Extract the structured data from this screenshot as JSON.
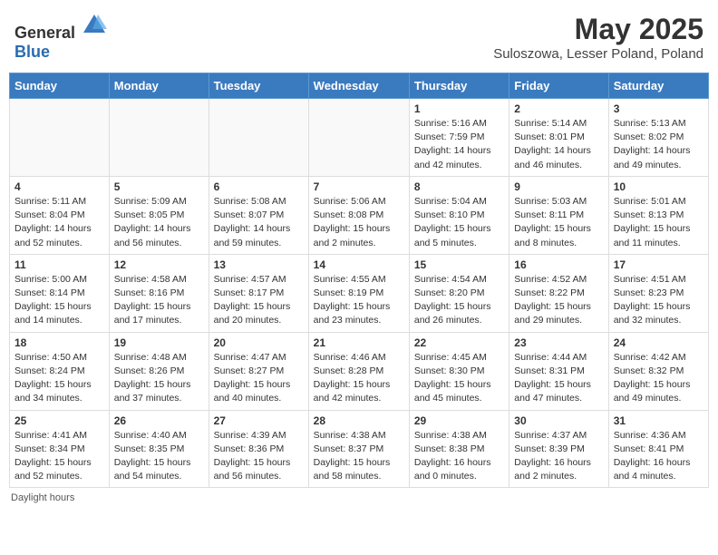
{
  "header": {
    "logo_general": "General",
    "logo_blue": "Blue",
    "title": "May 2025",
    "location": "Suloszowa, Lesser Poland, Poland"
  },
  "weekdays": [
    "Sunday",
    "Monday",
    "Tuesday",
    "Wednesday",
    "Thursday",
    "Friday",
    "Saturday"
  ],
  "weeks": [
    [
      {
        "day": "",
        "sunrise": "",
        "sunset": "",
        "daylight": ""
      },
      {
        "day": "",
        "sunrise": "",
        "sunset": "",
        "daylight": ""
      },
      {
        "day": "",
        "sunrise": "",
        "sunset": "",
        "daylight": ""
      },
      {
        "day": "",
        "sunrise": "",
        "sunset": "",
        "daylight": ""
      },
      {
        "day": "1",
        "sunrise": "Sunrise: 5:16 AM",
        "sunset": "Sunset: 7:59 PM",
        "daylight": "Daylight: 14 hours and 42 minutes."
      },
      {
        "day": "2",
        "sunrise": "Sunrise: 5:14 AM",
        "sunset": "Sunset: 8:01 PM",
        "daylight": "Daylight: 14 hours and 46 minutes."
      },
      {
        "day": "3",
        "sunrise": "Sunrise: 5:13 AM",
        "sunset": "Sunset: 8:02 PM",
        "daylight": "Daylight: 14 hours and 49 minutes."
      }
    ],
    [
      {
        "day": "4",
        "sunrise": "Sunrise: 5:11 AM",
        "sunset": "Sunset: 8:04 PM",
        "daylight": "Daylight: 14 hours and 52 minutes."
      },
      {
        "day": "5",
        "sunrise": "Sunrise: 5:09 AM",
        "sunset": "Sunset: 8:05 PM",
        "daylight": "Daylight: 14 hours and 56 minutes."
      },
      {
        "day": "6",
        "sunrise": "Sunrise: 5:08 AM",
        "sunset": "Sunset: 8:07 PM",
        "daylight": "Daylight: 14 hours and 59 minutes."
      },
      {
        "day": "7",
        "sunrise": "Sunrise: 5:06 AM",
        "sunset": "Sunset: 8:08 PM",
        "daylight": "Daylight: 15 hours and 2 minutes."
      },
      {
        "day": "8",
        "sunrise": "Sunrise: 5:04 AM",
        "sunset": "Sunset: 8:10 PM",
        "daylight": "Daylight: 15 hours and 5 minutes."
      },
      {
        "day": "9",
        "sunrise": "Sunrise: 5:03 AM",
        "sunset": "Sunset: 8:11 PM",
        "daylight": "Daylight: 15 hours and 8 minutes."
      },
      {
        "day": "10",
        "sunrise": "Sunrise: 5:01 AM",
        "sunset": "Sunset: 8:13 PM",
        "daylight": "Daylight: 15 hours and 11 minutes."
      }
    ],
    [
      {
        "day": "11",
        "sunrise": "Sunrise: 5:00 AM",
        "sunset": "Sunset: 8:14 PM",
        "daylight": "Daylight: 15 hours and 14 minutes."
      },
      {
        "day": "12",
        "sunrise": "Sunrise: 4:58 AM",
        "sunset": "Sunset: 8:16 PM",
        "daylight": "Daylight: 15 hours and 17 minutes."
      },
      {
        "day": "13",
        "sunrise": "Sunrise: 4:57 AM",
        "sunset": "Sunset: 8:17 PM",
        "daylight": "Daylight: 15 hours and 20 minutes."
      },
      {
        "day": "14",
        "sunrise": "Sunrise: 4:55 AM",
        "sunset": "Sunset: 8:19 PM",
        "daylight": "Daylight: 15 hours and 23 minutes."
      },
      {
        "day": "15",
        "sunrise": "Sunrise: 4:54 AM",
        "sunset": "Sunset: 8:20 PM",
        "daylight": "Daylight: 15 hours and 26 minutes."
      },
      {
        "day": "16",
        "sunrise": "Sunrise: 4:52 AM",
        "sunset": "Sunset: 8:22 PM",
        "daylight": "Daylight: 15 hours and 29 minutes."
      },
      {
        "day": "17",
        "sunrise": "Sunrise: 4:51 AM",
        "sunset": "Sunset: 8:23 PM",
        "daylight": "Daylight: 15 hours and 32 minutes."
      }
    ],
    [
      {
        "day": "18",
        "sunrise": "Sunrise: 4:50 AM",
        "sunset": "Sunset: 8:24 PM",
        "daylight": "Daylight: 15 hours and 34 minutes."
      },
      {
        "day": "19",
        "sunrise": "Sunrise: 4:48 AM",
        "sunset": "Sunset: 8:26 PM",
        "daylight": "Daylight: 15 hours and 37 minutes."
      },
      {
        "day": "20",
        "sunrise": "Sunrise: 4:47 AM",
        "sunset": "Sunset: 8:27 PM",
        "daylight": "Daylight: 15 hours and 40 minutes."
      },
      {
        "day": "21",
        "sunrise": "Sunrise: 4:46 AM",
        "sunset": "Sunset: 8:28 PM",
        "daylight": "Daylight: 15 hours and 42 minutes."
      },
      {
        "day": "22",
        "sunrise": "Sunrise: 4:45 AM",
        "sunset": "Sunset: 8:30 PM",
        "daylight": "Daylight: 15 hours and 45 minutes."
      },
      {
        "day": "23",
        "sunrise": "Sunrise: 4:44 AM",
        "sunset": "Sunset: 8:31 PM",
        "daylight": "Daylight: 15 hours and 47 minutes."
      },
      {
        "day": "24",
        "sunrise": "Sunrise: 4:42 AM",
        "sunset": "Sunset: 8:32 PM",
        "daylight": "Daylight: 15 hours and 49 minutes."
      }
    ],
    [
      {
        "day": "25",
        "sunrise": "Sunrise: 4:41 AM",
        "sunset": "Sunset: 8:34 PM",
        "daylight": "Daylight: 15 hours and 52 minutes."
      },
      {
        "day": "26",
        "sunrise": "Sunrise: 4:40 AM",
        "sunset": "Sunset: 8:35 PM",
        "daylight": "Daylight: 15 hours and 54 minutes."
      },
      {
        "day": "27",
        "sunrise": "Sunrise: 4:39 AM",
        "sunset": "Sunset: 8:36 PM",
        "daylight": "Daylight: 15 hours and 56 minutes."
      },
      {
        "day": "28",
        "sunrise": "Sunrise: 4:38 AM",
        "sunset": "Sunset: 8:37 PM",
        "daylight": "Daylight: 15 hours and 58 minutes."
      },
      {
        "day": "29",
        "sunrise": "Sunrise: 4:38 AM",
        "sunset": "Sunset: 8:38 PM",
        "daylight": "Daylight: 16 hours and 0 minutes."
      },
      {
        "day": "30",
        "sunrise": "Sunrise: 4:37 AM",
        "sunset": "Sunset: 8:39 PM",
        "daylight": "Daylight: 16 hours and 2 minutes."
      },
      {
        "day": "31",
        "sunrise": "Sunrise: 4:36 AM",
        "sunset": "Sunset: 8:41 PM",
        "daylight": "Daylight: 16 hours and 4 minutes."
      }
    ]
  ],
  "footer": "Daylight hours"
}
